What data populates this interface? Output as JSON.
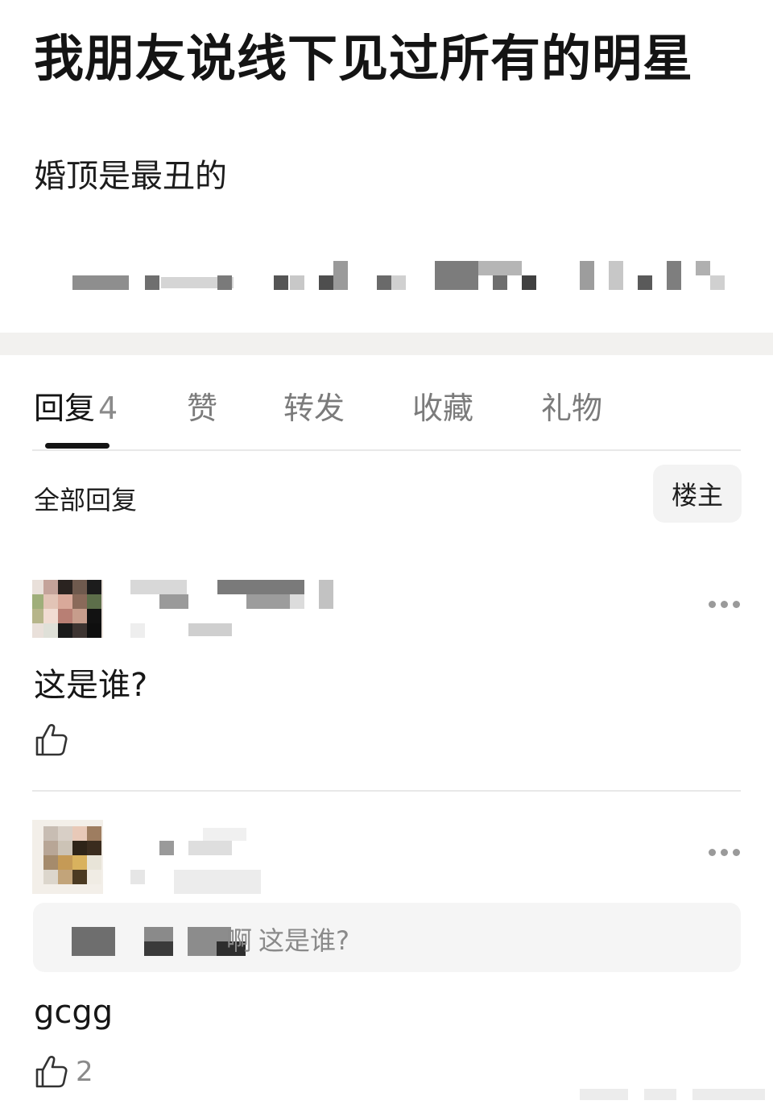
{
  "post": {
    "title": "我朋友说线下见过所有的明星",
    "body": "婚顶是最丑的"
  },
  "tabs": [
    {
      "label": "回复",
      "count": "4",
      "active": true
    },
    {
      "label": "赞"
    },
    {
      "label": "转发"
    },
    {
      "label": "收藏"
    },
    {
      "label": "礼物"
    }
  ],
  "filter_bar": {
    "all_replies_label": "全部回复",
    "op_only_label": "楼主"
  },
  "comments": [
    {
      "text": "这是谁?",
      "like_count": "",
      "more_icon": "more-dots-icon",
      "like_icon": "thumbs-up-icon"
    },
    {
      "quote": {
        "name_suffix": "啊",
        "text": "这是谁?"
      },
      "text": "gcgg",
      "like_count": "2",
      "more_icon": "more-dots-icon",
      "like_icon": "thumbs-up-icon"
    }
  ],
  "colors": {
    "text_primary": "#141414",
    "text_secondary": "#8a8a8a",
    "section_gap": "#f2f1ef",
    "chip_bg": "#f3f3f3"
  }
}
